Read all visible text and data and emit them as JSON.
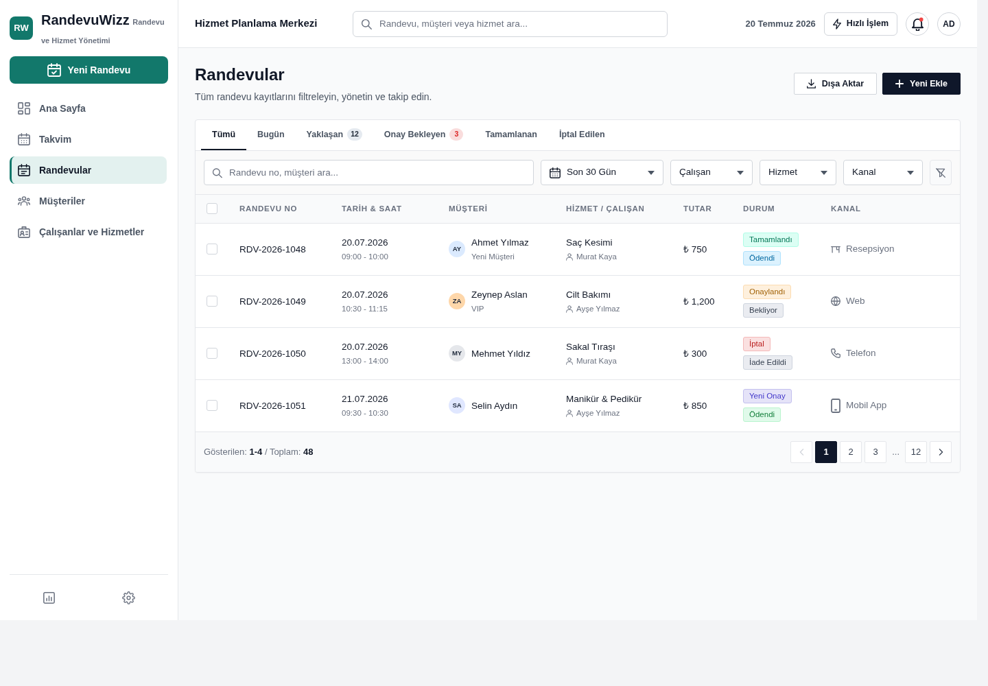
{
  "brand": {
    "logo": "RW",
    "name": "RandevuWizz",
    "tagline": "Randevu ve Hizmet Yönetimi"
  },
  "sidebar": {
    "primary_button": "Yeni Randevu",
    "items": [
      {
        "label": "Ana Sayfa",
        "selected": false
      },
      {
        "label": "Takvim",
        "selected": false
      },
      {
        "label": "Randevular",
        "selected": true
      },
      {
        "label": "Müşteriler",
        "selected": false
      },
      {
        "label": "Çalışanlar ve Hizmetler",
        "selected": false
      }
    ]
  },
  "header": {
    "title": "Hizmet Planlama Merkezi",
    "search": {
      "placeholder": "Randevu, müşteri veya hizmet ara..."
    },
    "date": "20 Temmuz 2026",
    "quick_action": "Hızlı İşlem",
    "notifications_unread": true,
    "user_initials": "AD"
  },
  "page": {
    "title": "Randevular",
    "subtitle": "Tüm randevu kayıtlarını filtreleyin, yönetin ve takip edin.",
    "buttons": [
      {
        "kind": "export",
        "label": "Dışa Aktar"
      },
      {
        "kind": "add",
        "label": "Yeni Ekle"
      }
    ]
  },
  "tabs": [
    {
      "label": "Tümü",
      "selected": true
    },
    {
      "label": "Bugün",
      "selected": false
    },
    {
      "label": "Yaklaşan",
      "selected": false,
      "count": {
        "text": "12",
        "color": "#1f2937"
      }
    },
    {
      "label": "Onay Bekleyen",
      "selected": false,
      "count": {
        "text": "3",
        "color": "#dc2626"
      }
    },
    {
      "label": "Tamamlanan",
      "selected": false
    },
    {
      "label": "İptal Edilen",
      "selected": false
    }
  ],
  "filters": {
    "search": {
      "placeholder": "Randevu no, müşteri ara..."
    },
    "dropdowns": [
      {
        "kind": "date",
        "value": "Son 30 Gün"
      },
      {
        "kind": "plain",
        "value": "Çalışan"
      },
      {
        "kind": "plain",
        "value": "Hizmet"
      },
      {
        "kind": "plain",
        "value": "Kanal"
      }
    ]
  },
  "table": {
    "select_all_checked": false,
    "columns": [
      "RANDEVU NO",
      "TARİH & SAAT",
      "MÜŞTERİ",
      "HİZMET / ÇALIŞAN",
      "TUTAR",
      "DURUM",
      "KANAL"
    ],
    "rows": [
      {
        "checked": false,
        "id": "RDV-2026-1048",
        "date": "20.07.2026",
        "time": "09:00 - 10:00",
        "customer": {
          "initials": "AY",
          "name": "Ahmet Yılmaz",
          "note": "Yeni Müşteri",
          "color": "#dbeafe"
        },
        "service": "Saç Kesimi",
        "staff": "Murat Kaya",
        "amount": "₺ 750",
        "status": [
          {
            "label": "Tamamlandı",
            "color": "#047857"
          },
          {
            "label": "Ödendi",
            "color": "#0369a1"
          }
        ],
        "channel": {
          "kind": "desk",
          "label": "Resepsiyon"
        }
      },
      {
        "checked": false,
        "id": "RDV-2026-1049",
        "date": "20.07.2026",
        "time": "10:30 - 11:15",
        "customer": {
          "initials": "ZA",
          "name": "Zeynep Aslan",
          "note": "VIP",
          "color": "#fed7aa"
        },
        "service": "Cilt Bakımı",
        "staff": "Ayşe Yılmaz",
        "amount": "₺ 1,200",
        "status": [
          {
            "label": "Onaylandı",
            "color": "#a16207"
          },
          {
            "label": "Bekliyor",
            "color": "#374151"
          }
        ],
        "channel": {
          "kind": "web",
          "label": "Web"
        }
      },
      {
        "checked": false,
        "id": "RDV-2026-1050",
        "date": "20.07.2026",
        "time": "13:00 - 14:00",
        "customer": {
          "initials": "MY",
          "name": "Mehmet Yıldız",
          "color": "#e5e7eb"
        },
        "service": "Sakal Tıraşı",
        "staff": "Murat Kaya",
        "amount": "₺ 300",
        "status": [
          {
            "label": "İptal",
            "color": "#b91c1c"
          },
          {
            "label": "İade Edildi",
            "color": "#374151"
          }
        ],
        "channel": {
          "kind": "phone",
          "label": "Telefon"
        }
      },
      {
        "checked": false,
        "id": "RDV-2026-1051",
        "date": "21.07.2026",
        "time": "09:30 - 10:30",
        "customer": {
          "initials": "SA",
          "name": "Selin Aydın",
          "color": "#e0e7ff"
        },
        "service": "Manikür & Pedikür",
        "staff": "Ayşe Yılmaz",
        "amount": "₺ 850",
        "status": [
          {
            "label": "Yeni Onay",
            "color": "#4338ca"
          },
          {
            "label": "Ödendi",
            "color": "#15803d"
          }
        ],
        "channel": {
          "kind": "mobile",
          "label": "Mobil App"
        }
      }
    ]
  },
  "pagination": {
    "summary": "Gösterilen: **1-4** / Toplam: **48**",
    "prev_disabled": true,
    "next_disabled": false,
    "pages": [
      {
        "kind": "page",
        "label": "1",
        "selected": true
      },
      {
        "kind": "page",
        "label": "2",
        "selected": false
      },
      {
        "kind": "page",
        "label": "3",
        "selected": false
      },
      {
        "kind": "gap",
        "label": "..."
      },
      {
        "kind": "page",
        "label": "12",
        "selected": false
      }
    ]
  }
}
